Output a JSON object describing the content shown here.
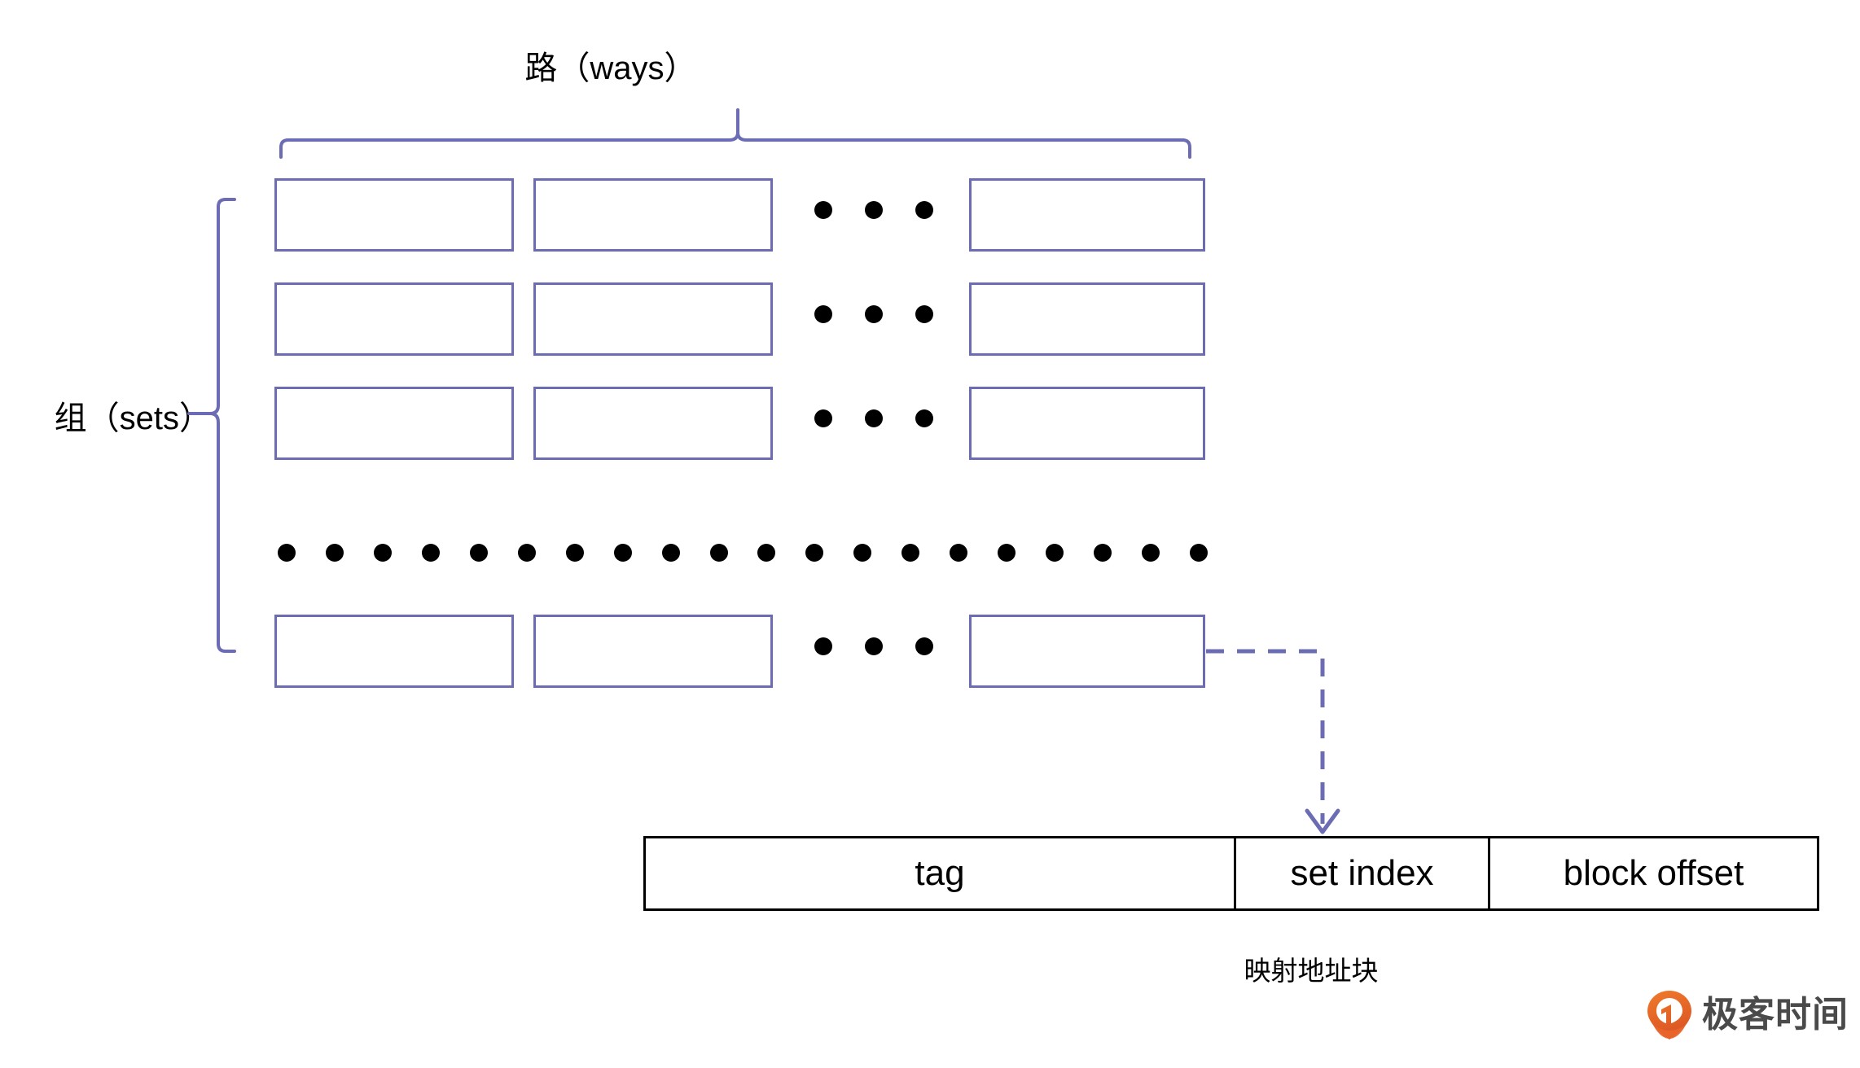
{
  "diagram": {
    "title_top": "路（ways）",
    "label_left": "组（sets）",
    "caption_bottom": "映射地址块",
    "colors": {
      "cell_border": "#6C6CB4",
      "bracket": "#6C6CB4",
      "arrow": "#6C6CB4",
      "dot": "#000000",
      "address_border": "#000000",
      "logo_orange": "#E8652A",
      "logo_text": "#4A4A4A"
    },
    "grid": {
      "rows": 4,
      "visible_columns": 3,
      "ellipsis_per_row": 3,
      "row_ellipsis_count": 20,
      "cells": [
        [
          "",
          "",
          ""
        ],
        [
          "",
          "",
          ""
        ],
        [
          "",
          "",
          ""
        ],
        [
          "",
          "",
          ""
        ]
      ]
    },
    "address_block": {
      "fields": [
        {
          "name": "tag",
          "label": "tag"
        },
        {
          "name": "set-index",
          "label": "set index"
        },
        {
          "name": "block-offset",
          "label": "block offset"
        }
      ]
    },
    "logo": {
      "wordmark": "极客时间",
      "icon": "geektime-balloon-icon"
    }
  }
}
